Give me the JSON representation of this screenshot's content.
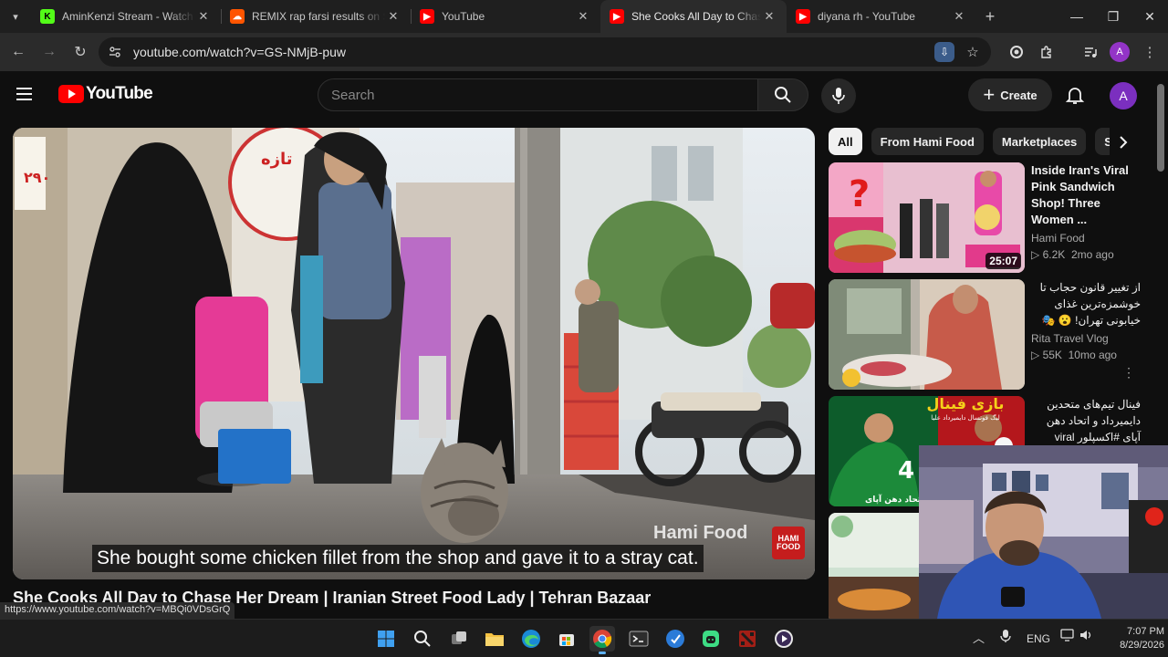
{
  "browser": {
    "tabs": [
      {
        "title": "AminKenzi Stream - Watch Liv",
        "favicon": "kick-icon",
        "color": "#53fc18",
        "glyph": "K",
        "active": false
      },
      {
        "title": "REMIX rap farsi results on Sou",
        "favicon": "soundcloud-icon",
        "color": "#ff5500",
        "glyph": "☁",
        "active": false
      },
      {
        "title": "YouTube",
        "favicon": "youtube-icon",
        "color": "#ff0000",
        "glyph": "▶",
        "active": false
      },
      {
        "title": "She Cooks All Day to Chase He",
        "favicon": "youtube-icon",
        "color": "#ff0000",
        "glyph": "▶",
        "active": true
      },
      {
        "title": "diyana rh - YouTube",
        "favicon": "youtube-icon",
        "color": "#ff0000",
        "glyph": "▶",
        "active": false
      }
    ],
    "url": "youtube.com/watch?v=GS-NMjB-puw",
    "profile_initial": "A",
    "status_url": "https://www.youtube.com/watch?v=MBQi0VDsGrQ"
  },
  "youtube": {
    "logo_text": "YouTube",
    "search_placeholder": "Search",
    "create_label": "Create",
    "avatar_initial": "A",
    "brand_color": "#ff0000"
  },
  "player": {
    "caption": "She bought some chicken fillet from the shop and gave it to a stray cat.",
    "watermark": "Hami Food",
    "channel_logo_text": "HAMI FOOD",
    "video_title": "She Cooks All Day to Chase Her Dream | Iranian Street Food Lady | Tehran Bazaar"
  },
  "chips": [
    "All",
    "From Hami Food",
    "Marketplaces",
    "St"
  ],
  "recommendations": [
    {
      "title": "Inside Iran's Viral Pink Sandwich Shop! Three Women ...",
      "channel": "Hami Food",
      "views": "6.2K",
      "age": "2mo ago",
      "duration": "25:07",
      "rtl": false
    },
    {
      "title": "از تغییر قانون حجاب تا خوشمزه‌ترین غذای خیابونی تهران! 😮 🎭",
      "channel": "Rita Travel Vlog",
      "views": "55K",
      "age": "10mo ago",
      "duration": "",
      "rtl": true
    },
    {
      "title": "فینال تیم‌های متحدین دایمیرداد و اتحاد دهن آپای #اکسپلور viral #foryou# ...",
      "channel": "",
      "views": "",
      "age": "",
      "duration": "",
      "rtl": true,
      "thumb_text": "بازی فینال",
      "thumb_sub": "لیگ فوتسال دایمیرداد علیا",
      "thumb_team": "اتحاد دهن آپای",
      "thumb_number": "4"
    },
    {
      "title": "",
      "channel": "",
      "views": "",
      "age": "",
      "duration": "",
      "rtl": false
    }
  ],
  "taskbar": {
    "apps": [
      "windows-start-icon",
      "search-icon",
      "task-view-icon",
      "file-explorer-icon",
      "edge-icon",
      "store-icon",
      "chrome-icon",
      "terminal-icon",
      "vscode-icon",
      "android-icon",
      "dota-icon",
      "media-player-icon"
    ],
    "lang": "ENG",
    "time": "7:07 PM",
    "date": "8/29/2026"
  }
}
